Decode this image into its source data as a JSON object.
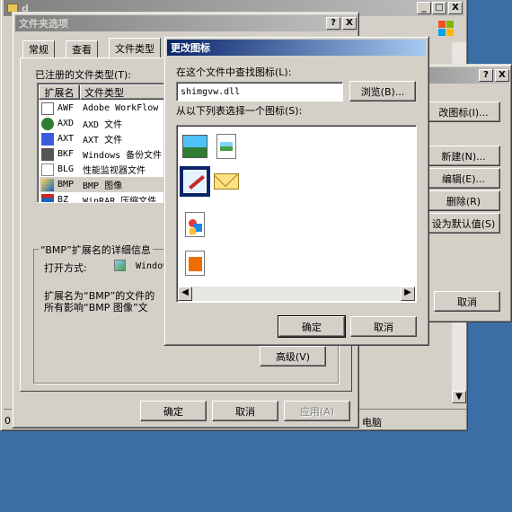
{
  "bg_window": {
    "title": "d",
    "buttons": [
      "_",
      "□",
      "X"
    ],
    "status_text": "电脑"
  },
  "folder_options": {
    "title": "文件夹选项",
    "title_buttons": [
      "?",
      "X"
    ],
    "tabs": [
      "常规",
      "查看",
      "文件类型"
    ],
    "registered_label": "已注册的文件类型(T):",
    "columns": {
      "ext": "扩展名",
      "type": "文件类型"
    },
    "rows": [
      {
        "ext": "AWF",
        "type": "Adobe WorkFlow"
      },
      {
        "ext": "AXD",
        "type": "AXD 文件"
      },
      {
        "ext": "AXT",
        "type": "AXT 文件"
      },
      {
        "ext": "BKF",
        "type": "Windows 备份文件"
      },
      {
        "ext": "BLG",
        "type": "性能监视器文件"
      },
      {
        "ext": "BMP",
        "type": "BMP 图像"
      },
      {
        "ext": "BZ",
        "type": "WinRAR 压缩文件"
      }
    ],
    "details_title": "“BMP”扩展名的详细信息",
    "open_with_label": "打开方式:",
    "open_with_value": "Window",
    "description_line1": "扩展名为“BMP”的文件的",
    "description_line2": "所有影响“BMP 图像”文",
    "advanced_button": "高级(V)",
    "ok_button": "确定",
    "cancel_button": "取消",
    "apply_button": "应用(A)"
  },
  "edit_type": {
    "title_buttons": [
      "?",
      "X"
    ],
    "change_icon_button": "改图标(I)...",
    "new_button": "新建(N)...",
    "edit_button": "编辑(E)...",
    "delete_button": "删除(R)",
    "set_default_button": "设为默认值(S)",
    "cancel_button": "取消"
  },
  "change_icon": {
    "title": "更改图标",
    "find_label": "在这个文件中查找图标(L):",
    "file_value": "shimgvw.dll",
    "browse_button": "浏览(B)...",
    "select_label": "从以下列表选择一个图标(S):",
    "icons": [
      "picture-icon",
      "image-document-icon",
      "paint-brush-icon",
      "envelope-icon",
      "shapes-document-icon",
      "slides-document-icon"
    ],
    "ok_button": "确定",
    "cancel_button": "取消"
  }
}
